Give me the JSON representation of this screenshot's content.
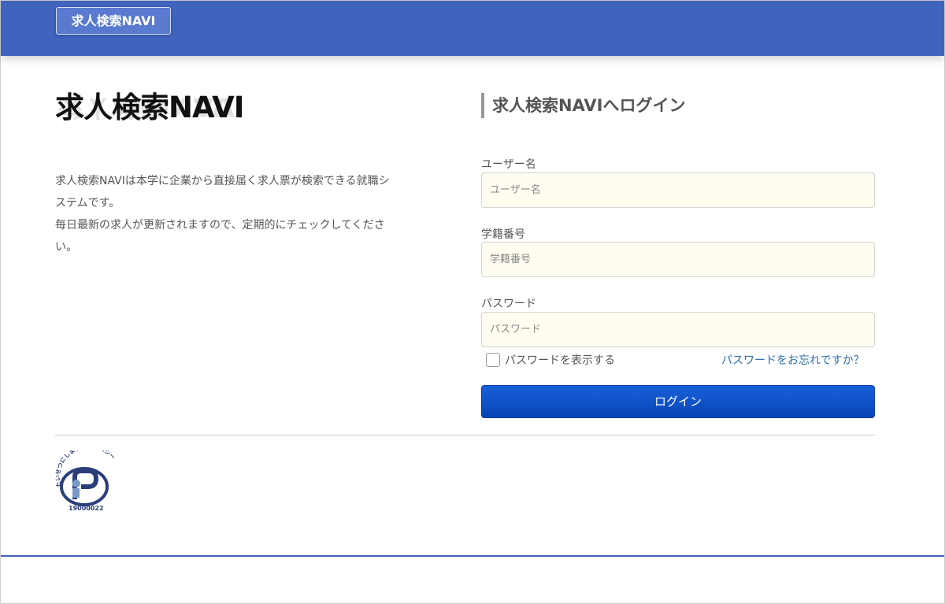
{
  "header": {
    "brand_label": "求人検索NAVI"
  },
  "logo": {
    "text": "求人検索NAVI"
  },
  "description": {
    "paragraph_1": "求人検索NAVIは本学に企業から直接届く求人票が検索できる就職システムです。",
    "paragraph_2": "毎日最新の求人が更新されますので、定期的にチェックしてください。"
  },
  "login_form": {
    "title": "求人検索NAVIへログイン",
    "username": {
      "label": "ユーザー名",
      "placeholder": "ユーザー名",
      "value": ""
    },
    "student_id": {
      "label": "学籍番号",
      "placeholder": "学籍番号",
      "value": ""
    },
    "password": {
      "label": "パスワード",
      "placeholder": "パスワード",
      "value": ""
    },
    "show_password_label": "パスワードを表示する",
    "show_password_checked": false,
    "forgot_link": "パスワードをお忘れですか？",
    "submit_label": "ログイン"
  },
  "footer": {
    "privacy_mark_text": "たいせつにしますプライバシー",
    "privacy_mark_number": "19000022"
  },
  "colors": {
    "header_bg": "#4063bd",
    "button_bg": "#0a52d0",
    "input_bg": "#fffdf0",
    "link": "#2f6fb0"
  }
}
